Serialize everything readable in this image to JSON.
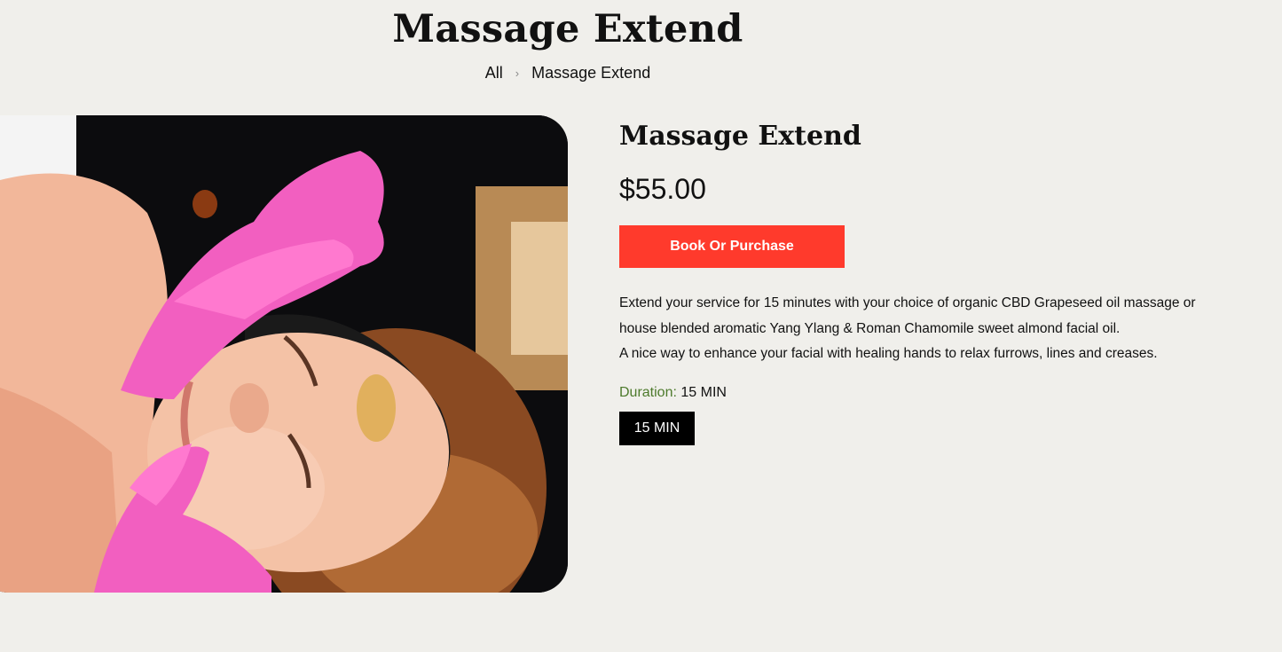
{
  "page": {
    "title": "Massage Extend",
    "breadcrumb": {
      "home": "All",
      "separator": "›",
      "current": "Massage Extend"
    }
  },
  "product": {
    "image_icon": "spa-facial-photo",
    "title": "Massage Extend",
    "price": "$55.00",
    "book_label": "Book Or Purchase",
    "description": [
      "Extend your service for 15 minutes with your choice of organic CBD Grapeseed oil massage or",
      "house blended aromatic Yang Ylang & Roman Chamomile sweet almond facial oil.",
      "A nice way to enhance your facial with healing hands to relax furrows, lines and creases."
    ],
    "duration_label": "Duration:",
    "duration_value": "15 MIN",
    "duration_option": "15 MIN"
  },
  "colors": {
    "background": "#f0efeb",
    "book_button": "#ff3a2c",
    "duration_label": "#4d7a2c",
    "chip": "#000000"
  }
}
